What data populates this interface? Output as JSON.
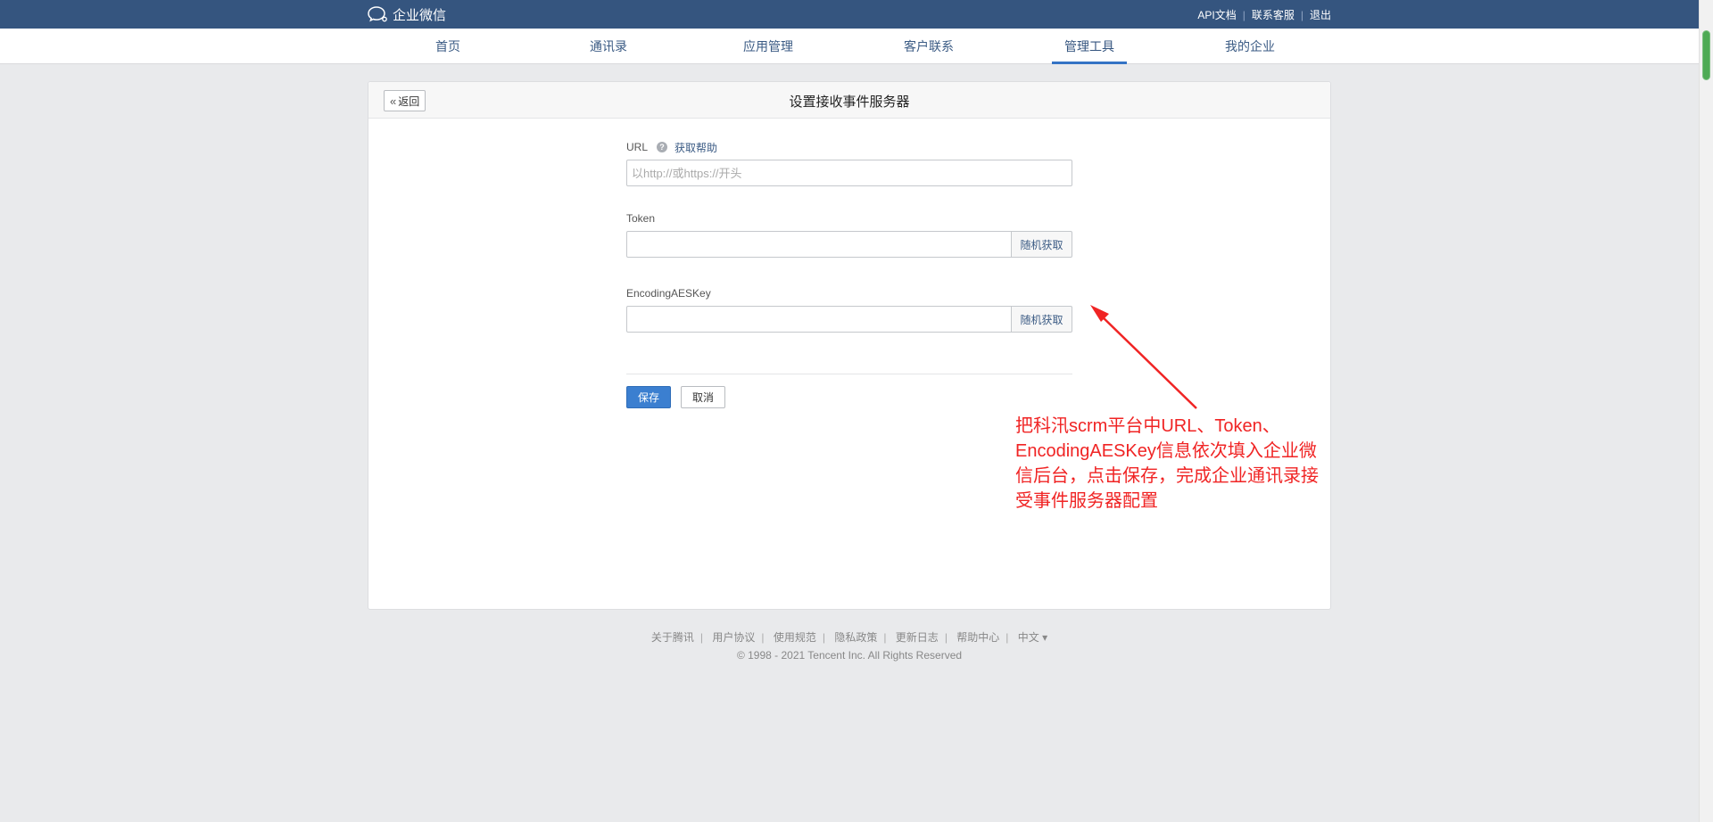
{
  "topbar": {
    "logo_text": "企业微信",
    "links": [
      "API文档",
      "联系客服",
      "退出"
    ]
  },
  "nav": {
    "items": [
      "首页",
      "通讯录",
      "应用管理",
      "客户联系",
      "管理工具",
      "我的企业"
    ],
    "active": "管理工具"
  },
  "card": {
    "back_label": "返回",
    "title": "设置接收事件服务器"
  },
  "form": {
    "url_label": "URL",
    "help_link": "获取帮助",
    "url_placeholder": "以http://或https://开头",
    "url_value": "",
    "token_label": "Token",
    "token_value": "",
    "token_button": "随机获取",
    "aes_label": "EncodingAESKey",
    "aes_value": "",
    "aes_button": "随机获取",
    "save_label": "保存",
    "cancel_label": "取消"
  },
  "annotation": {
    "text": "把科汛scrm平台中URL、Token、EncodingAESKey信息依次填入企业微信后台，点击保存，完成企业通讯录接受事件服务器配置",
    "color": "#f02424"
  },
  "footer": {
    "links": [
      "关于腾讯",
      "用户协议",
      "使用规范",
      "隐私政策",
      "更新日志",
      "帮助中心",
      "中文 ▾"
    ],
    "copyright": "© 1998 - 2021 Tencent Inc. All Rights Reserved"
  },
  "colors": {
    "topbar": "#35557f",
    "accent": "#3b7fd0",
    "link": "#3b5b84"
  }
}
